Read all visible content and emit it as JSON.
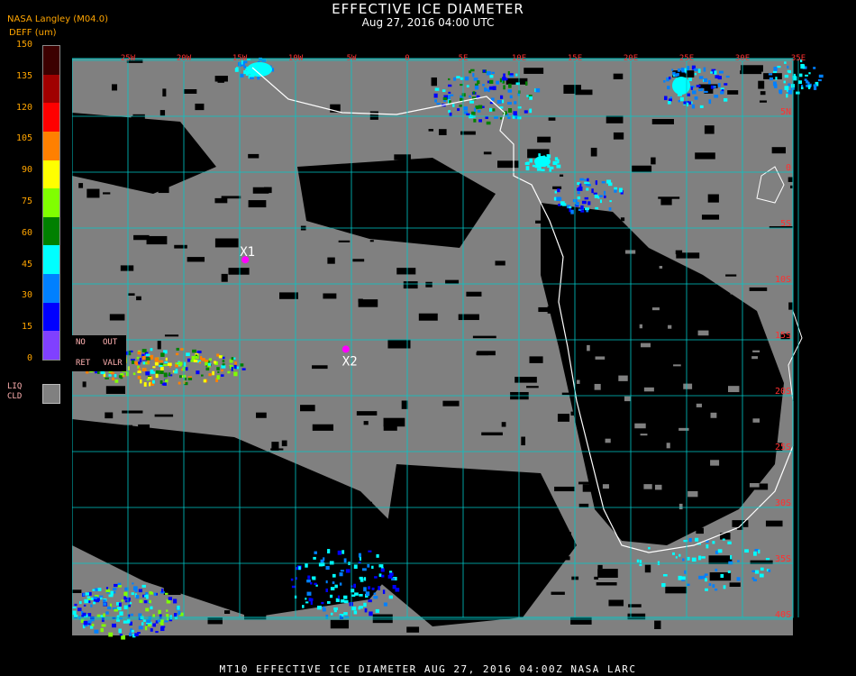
{
  "header": {
    "title": "EFFECTIVE ICE DIAMETER",
    "subtitle": "Aug 27, 2016 04:00 UTC",
    "org": "NASA Langley (M04.0)",
    "unit": "DEFF (um)"
  },
  "legend": {
    "ticks": [
      "150",
      "135",
      "120",
      "105",
      "90",
      "75",
      "60",
      "45",
      "30",
      "15",
      "0"
    ],
    "colors": [
      "#3c0000",
      "#a00000",
      "#ff0000",
      "#ff8000",
      "#ffff00",
      "#80ff00",
      "#008000",
      "#00ffff",
      "#0080ff",
      "#0000ff",
      "#8040ff"
    ],
    "no_ret": [
      "NO",
      "RET"
    ],
    "out_valr": [
      "OUT",
      "VALR"
    ],
    "liq_cld": [
      "LIQ",
      "CLD"
    ],
    "liq_color": "#808080"
  },
  "map": {
    "lat_labels": [
      "5N",
      "0",
      "5S",
      "10S",
      "15S",
      "20S",
      "25S",
      "30S",
      "35S",
      "40S"
    ],
    "lon_labels": [
      "25W",
      "20W",
      "15W",
      "10W",
      "5W",
      "0",
      "5E",
      "10E",
      "15E",
      "20E",
      "25E",
      "30E",
      "35E"
    ],
    "markers": [
      {
        "label": "X1",
        "lon": -14.5,
        "lat": -8.0
      },
      {
        "label": "X2",
        "lon": -5.5,
        "lat": -16.0
      }
    ],
    "grid_color": "#00c8c8",
    "label_color": "#ff3030",
    "marker_color": "#ff00ff",
    "background": "#000000",
    "ice_cloud_color": "#808080"
  },
  "footer": "MT10   EFFECTIVE ICE DIAMETER   AUG 27, 2016 04:00Z   NASA LARC"
}
